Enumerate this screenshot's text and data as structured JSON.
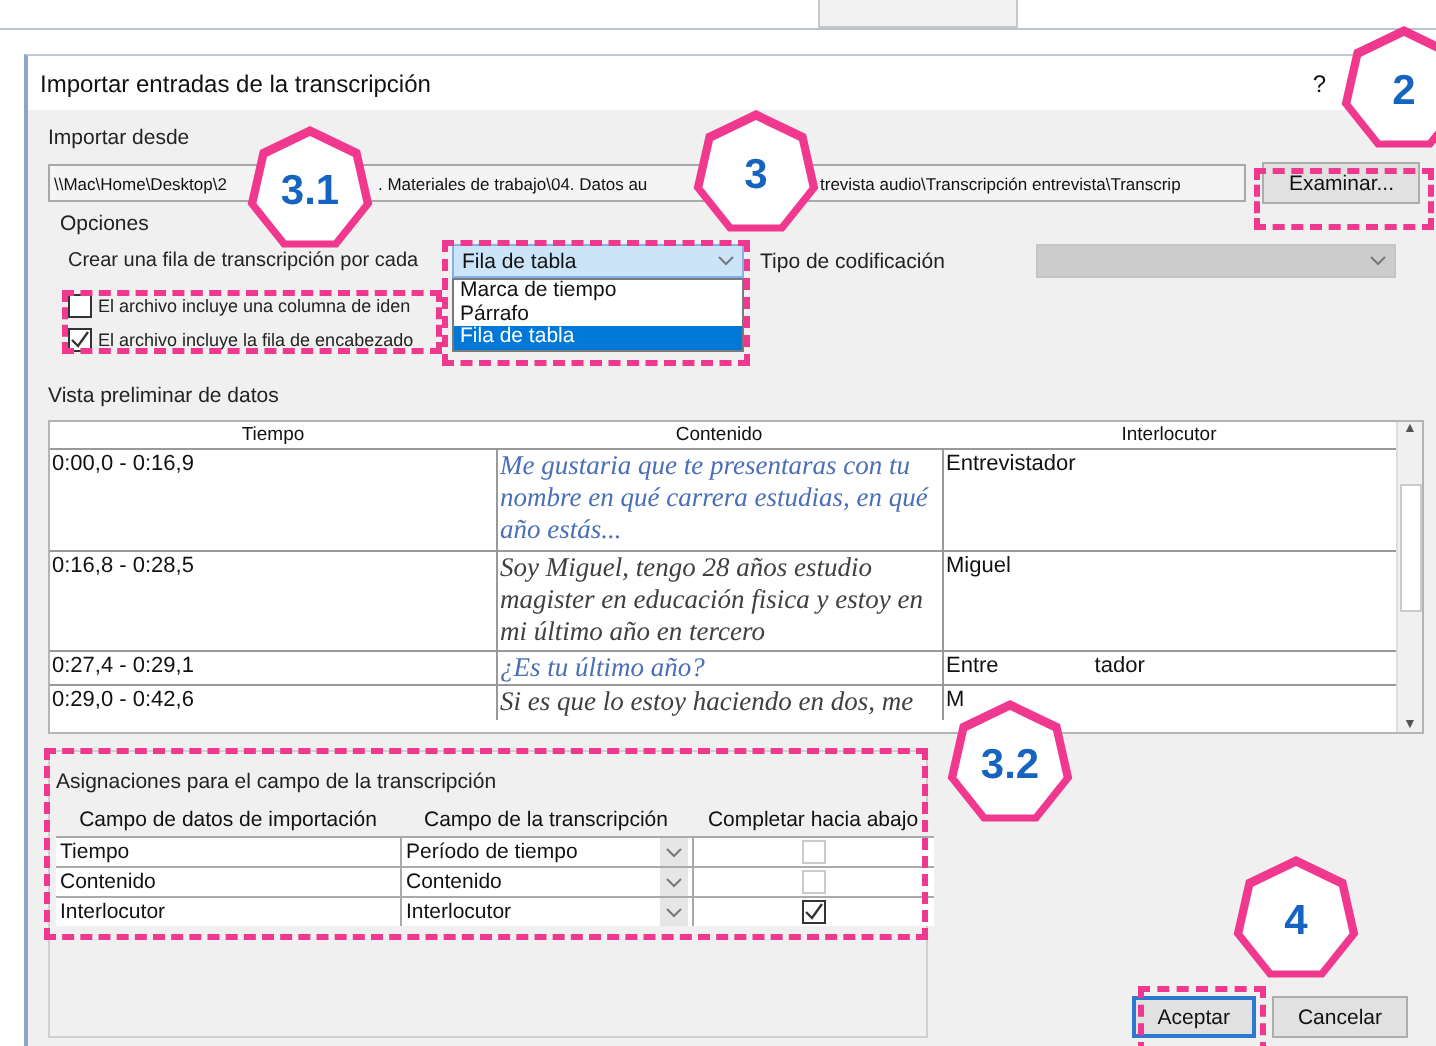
{
  "window": {
    "title": "Importar entradas de la transcripción",
    "help": "?"
  },
  "import_from": {
    "label": "Importar desde",
    "path_segments": [
      "\\\\Mac\\Home\\Desktop\\2",
      ". Materiales de trabajo\\04. Datos au",
      "trevista audio\\Transcripción entrevista\\Transcrip"
    ],
    "browse_button": "Examinar..."
  },
  "options": {
    "label": "Opciones",
    "row_label": "Crear una fila de transcripción por cada",
    "row_value": "Fila de tabla",
    "row_options": [
      {
        "label": "Marca de tiempo",
        "selected": false
      },
      {
        "label": "Párrafo",
        "selected": false
      },
      {
        "label": "Fila de tabla",
        "selected": true
      }
    ],
    "encoding_label": "Tipo de codificación",
    "encoding_disabled": true,
    "checkboxes": [
      {
        "label": "El archivo incluye una columna de iden",
        "checked": false
      },
      {
        "label": "El archivo incluye la fila de encabezado",
        "checked": true
      }
    ]
  },
  "preview": {
    "label": "Vista preliminar de datos",
    "scroll_up": "▲",
    "scroll_down": "▼",
    "columns": [
      "Tiempo",
      "Contenido",
      "Interlocutor"
    ],
    "rows": [
      {
        "time": "0:00,0 - 0:16,9",
        "content": "Me gustaria que te presentaras con tu nombre en qué carrera estudias, en qué año estás...",
        "speaker": [
          "Entrevistador"
        ],
        "color": "#4a6fb8"
      },
      {
        "time": "0:16,8 - 0:28,5",
        "content": " Soy Miguel, tengo 28 años estudio magister en educación fisica y estoy en mi último año en tercero",
        "speaker": [
          "Miguel"
        ],
        "color": "#404040"
      },
      {
        "time": "0:27,4 - 0:29,1",
        "content": "¿Es tu último año?",
        "speaker": [
          "Entre",
          "tador"
        ],
        "color": "#4a6fb8"
      },
      {
        "time": "0:29,0 - 0:42,6",
        "content": "Si es que lo estoy haciendo en dos, me",
        "speaker": [
          "M"
        ],
        "color": "#404040"
      }
    ]
  },
  "mapping": {
    "label": "Asignaciones para el campo de la transcripción",
    "columns": [
      "Campo de datos de importación",
      "Campo de la transcripción",
      "Completar hacia abajo"
    ],
    "rows": [
      {
        "source": "Tiempo",
        "target": "Período de tiempo",
        "fill_down": false
      },
      {
        "source": "Contenido",
        "target": "Contenido",
        "fill_down": false
      },
      {
        "source": "Interlocutor",
        "target": "Interlocutor",
        "fill_down": true
      }
    ]
  },
  "buttons": [
    {
      "label": "Aceptar",
      "default": true
    },
    {
      "label": "Cancelar",
      "default": false
    }
  ],
  "annotations": [
    {
      "label": "3.1"
    },
    {
      "label": "3"
    },
    {
      "label": "2"
    },
    {
      "label": "3.2"
    },
    {
      "label": "4"
    }
  ]
}
